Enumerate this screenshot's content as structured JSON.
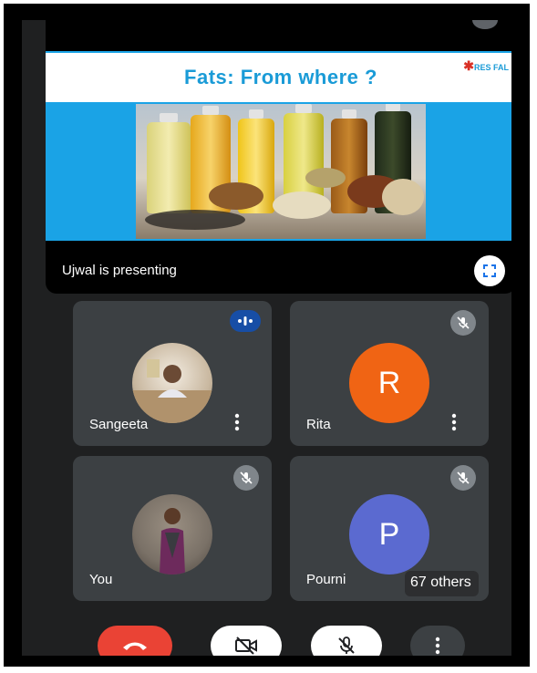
{
  "slide": {
    "title": "Fats: From where ?",
    "logo_text": "RES FAL"
  },
  "presentation": {
    "presenting_label": "Ujwal is presenting"
  },
  "participants": [
    {
      "name": "Sangeeta",
      "initial": "",
      "avatar_color": "#c9b8a0",
      "status": "speaking"
    },
    {
      "name": "Rita",
      "initial": "R",
      "avatar_color": "#f06414",
      "status": "muted"
    },
    {
      "name": "You",
      "initial": "",
      "avatar_color": "#7a7167",
      "status": "muted"
    },
    {
      "name": "Pourni",
      "initial": "P",
      "avatar_color": "#5b6ad0",
      "status": "muted"
    }
  ],
  "others_chip": "67 others",
  "controls": {
    "end_call_icon": "phone-hangup-icon",
    "camera_icon": "camera-off-icon",
    "mic_icon": "mic-off-icon",
    "more_icon": "more-vert-icon"
  },
  "colors": {
    "end_call": "#ea4335",
    "speaking": "#174ea6",
    "tile_bg": "#3c4043",
    "slide_blue": "#1aa3e6"
  }
}
